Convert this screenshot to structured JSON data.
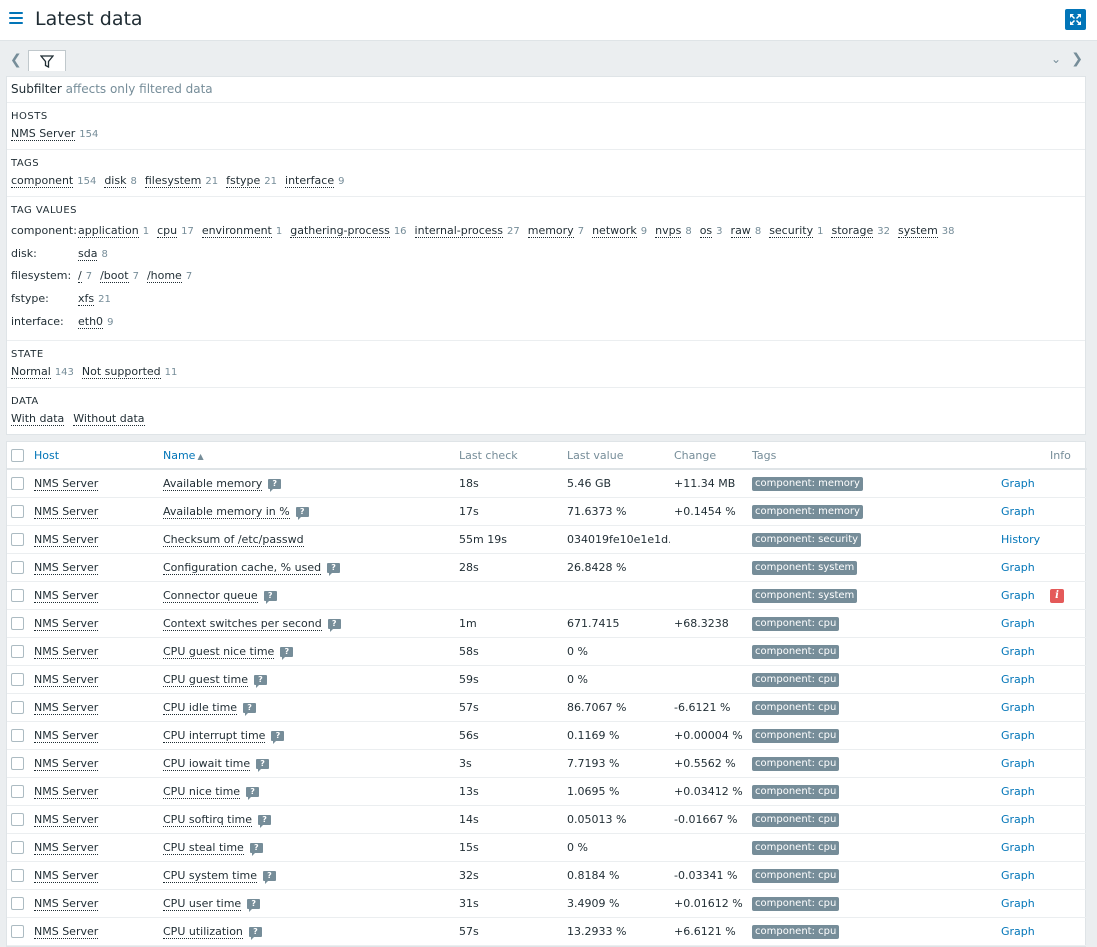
{
  "header": {
    "title": "Latest data"
  },
  "subfilter": {
    "title": "Subfilter",
    "note": "affects only filtered data",
    "hosts": {
      "label": "HOSTS",
      "items": [
        {
          "name": "NMS Server",
          "count": "154"
        }
      ]
    },
    "tags": {
      "label": "TAGS",
      "items": [
        {
          "name": "component",
          "count": "154"
        },
        {
          "name": "disk",
          "count": "8"
        },
        {
          "name": "filesystem",
          "count": "21"
        },
        {
          "name": "fstype",
          "count": "21"
        },
        {
          "name": "interface",
          "count": "9"
        }
      ]
    },
    "tag_values": {
      "label": "TAG VALUES",
      "rows": [
        {
          "key": "component:",
          "values": [
            {
              "name": "application",
              "count": "1"
            },
            {
              "name": "cpu",
              "count": "17"
            },
            {
              "name": "environment",
              "count": "1"
            },
            {
              "name": "gathering-process",
              "count": "16"
            },
            {
              "name": "internal-process",
              "count": "27"
            },
            {
              "name": "memory",
              "count": "7"
            },
            {
              "name": "network",
              "count": "9"
            },
            {
              "name": "nvps",
              "count": "8"
            },
            {
              "name": "os",
              "count": "3"
            },
            {
              "name": "raw",
              "count": "8"
            },
            {
              "name": "security",
              "count": "1"
            },
            {
              "name": "storage",
              "count": "32"
            },
            {
              "name": "system",
              "count": "38"
            }
          ]
        },
        {
          "key": "disk:",
          "values": [
            {
              "name": "sda",
              "count": "8"
            }
          ]
        },
        {
          "key": "filesystem:",
          "values": [
            {
              "name": "/",
              "count": "7"
            },
            {
              "name": "/boot",
              "count": "7"
            },
            {
              "name": "/home",
              "count": "7"
            }
          ]
        },
        {
          "key": "fstype:",
          "values": [
            {
              "name": "xfs",
              "count": "21"
            }
          ]
        },
        {
          "key": "interface:",
          "values": [
            {
              "name": "eth0",
              "count": "9"
            }
          ]
        }
      ]
    },
    "state": {
      "label": "STATE",
      "items": [
        {
          "name": "Normal",
          "count": "143"
        },
        {
          "name": "Not supported",
          "count": "11"
        }
      ]
    },
    "data": {
      "label": "DATA",
      "items": [
        {
          "name": "With data",
          "count": ""
        },
        {
          "name": "Without data",
          "count": ""
        }
      ]
    }
  },
  "table": {
    "columns": {
      "host": "Host",
      "name": "Name",
      "last_check": "Last check",
      "last_value": "Last value",
      "change": "Change",
      "tags": "Tags",
      "info": "Info"
    },
    "rows": [
      {
        "host": "NMS Server",
        "name": "Available memory",
        "hint": true,
        "last_check": "18s",
        "last_value": "5.46 GB",
        "change": "+11.34 MB",
        "tag": "component: memory",
        "action": "Graph",
        "info": false
      },
      {
        "host": "NMS Server",
        "name": "Available memory in %",
        "hint": true,
        "last_check": "17s",
        "last_value": "71.6373 %",
        "change": "+0.1454 %",
        "tag": "component: memory",
        "action": "Graph",
        "info": false
      },
      {
        "host": "NMS Server",
        "name": "Checksum of /etc/passwd",
        "hint": false,
        "last_check": "55m 19s",
        "last_value": "034019fe10e1e1d...",
        "change": "",
        "tag": "component: security",
        "action": "History",
        "info": false
      },
      {
        "host": "NMS Server",
        "name": "Configuration cache, % used",
        "hint": true,
        "last_check": "28s",
        "last_value": "26.8428 %",
        "change": "",
        "tag": "component: system",
        "action": "Graph",
        "info": false
      },
      {
        "host": "NMS Server",
        "name": "Connector queue",
        "hint": true,
        "last_check": "",
        "last_value": "",
        "change": "",
        "tag": "component: system",
        "action": "Graph",
        "info": true
      },
      {
        "host": "NMS Server",
        "name": "Context switches per second",
        "hint": true,
        "last_check": "1m",
        "last_value": "671.7415",
        "change": "+68.3238",
        "tag": "component: cpu",
        "action": "Graph",
        "info": false
      },
      {
        "host": "NMS Server",
        "name": "CPU guest nice time",
        "hint": true,
        "last_check": "58s",
        "last_value": "0 %",
        "change": "",
        "tag": "component: cpu",
        "action": "Graph",
        "info": false
      },
      {
        "host": "NMS Server",
        "name": "CPU guest time",
        "hint": true,
        "last_check": "59s",
        "last_value": "0 %",
        "change": "",
        "tag": "component: cpu",
        "action": "Graph",
        "info": false
      },
      {
        "host": "NMS Server",
        "name": "CPU idle time",
        "hint": true,
        "last_check": "57s",
        "last_value": "86.7067 %",
        "change": "-6.6121 %",
        "tag": "component: cpu",
        "action": "Graph",
        "info": false
      },
      {
        "host": "NMS Server",
        "name": "CPU interrupt time",
        "hint": true,
        "last_check": "56s",
        "last_value": "0.1169 %",
        "change": "+0.00004 %",
        "tag": "component: cpu",
        "action": "Graph",
        "info": false
      },
      {
        "host": "NMS Server",
        "name": "CPU iowait time",
        "hint": true,
        "last_check": "3s",
        "last_value": "7.7193 %",
        "change": "+0.5562 %",
        "tag": "component: cpu",
        "action": "Graph",
        "info": false
      },
      {
        "host": "NMS Server",
        "name": "CPU nice time",
        "hint": true,
        "last_check": "13s",
        "last_value": "1.0695 %",
        "change": "+0.03412 %",
        "tag": "component: cpu",
        "action": "Graph",
        "info": false
      },
      {
        "host": "NMS Server",
        "name": "CPU softirq time",
        "hint": true,
        "last_check": "14s",
        "last_value": "0.05013 %",
        "change": "-0.01667 %",
        "tag": "component: cpu",
        "action": "Graph",
        "info": false
      },
      {
        "host": "NMS Server",
        "name": "CPU steal time",
        "hint": true,
        "last_check": "15s",
        "last_value": "0 %",
        "change": "",
        "tag": "component: cpu",
        "action": "Graph",
        "info": false
      },
      {
        "host": "NMS Server",
        "name": "CPU system time",
        "hint": true,
        "last_check": "32s",
        "last_value": "0.8184 %",
        "change": "-0.03341 %",
        "tag": "component: cpu",
        "action": "Graph",
        "info": false
      },
      {
        "host": "NMS Server",
        "name": "CPU user time",
        "hint": true,
        "last_check": "31s",
        "last_value": "3.4909 %",
        "change": "+0.01612 %",
        "tag": "component: cpu",
        "action": "Graph",
        "info": false
      },
      {
        "host": "NMS Server",
        "name": "CPU utilization",
        "hint": true,
        "last_check": "57s",
        "last_value": "13.2933 %",
        "change": "+6.6121 %",
        "tag": "component: cpu",
        "action": "Graph",
        "info": false
      }
    ]
  },
  "icons": {
    "menu": "menu-icon",
    "kiosk": "fullscreen-icon",
    "filter": "filter-icon",
    "prev": "chevron-left-icon",
    "next": "chevron-right-icon",
    "collapse": "chevron-down-icon",
    "hint": "comment-icon",
    "info": "error-icon"
  },
  "colors": {
    "link": "#0275b8",
    "tag_bg": "#768d99",
    "error": "#e45959",
    "muted": "#768d99"
  }
}
